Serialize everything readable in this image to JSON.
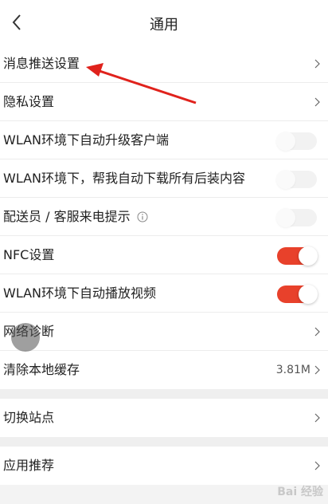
{
  "header": {
    "title": "通用",
    "back_icon": "chevron-left-icon"
  },
  "settings": [
    {
      "label": "消息推送设置",
      "control": "chevron"
    },
    {
      "label": "隐私设置",
      "control": "chevron"
    },
    {
      "label": "WLAN环境下自动升级客户端",
      "control": "toggle",
      "on": false
    },
    {
      "label": "WLAN环境下，帮我自动下载所有后装内容",
      "control": "toggle",
      "on": false
    },
    {
      "label": "配送员 / 客服来电提示",
      "control": "toggle",
      "on": false,
      "info_icon": "info-icon"
    },
    {
      "label": "NFC设置",
      "control": "toggle",
      "on": true
    },
    {
      "label": "WLAN环境下自动播放视频",
      "control": "toggle",
      "on": true
    },
    {
      "label": "网络诊断",
      "control": "chevron"
    },
    {
      "label": "清除本地缓存",
      "control": "chevron",
      "value": "3.81M"
    }
  ],
  "station": {
    "label": "切换站点"
  },
  "recommend": {
    "label": "应用推荐"
  },
  "colors": {
    "toggle_on": "#e8412b",
    "annotation_arrow": "#e0221c"
  },
  "watermark": "Bai 经验"
}
